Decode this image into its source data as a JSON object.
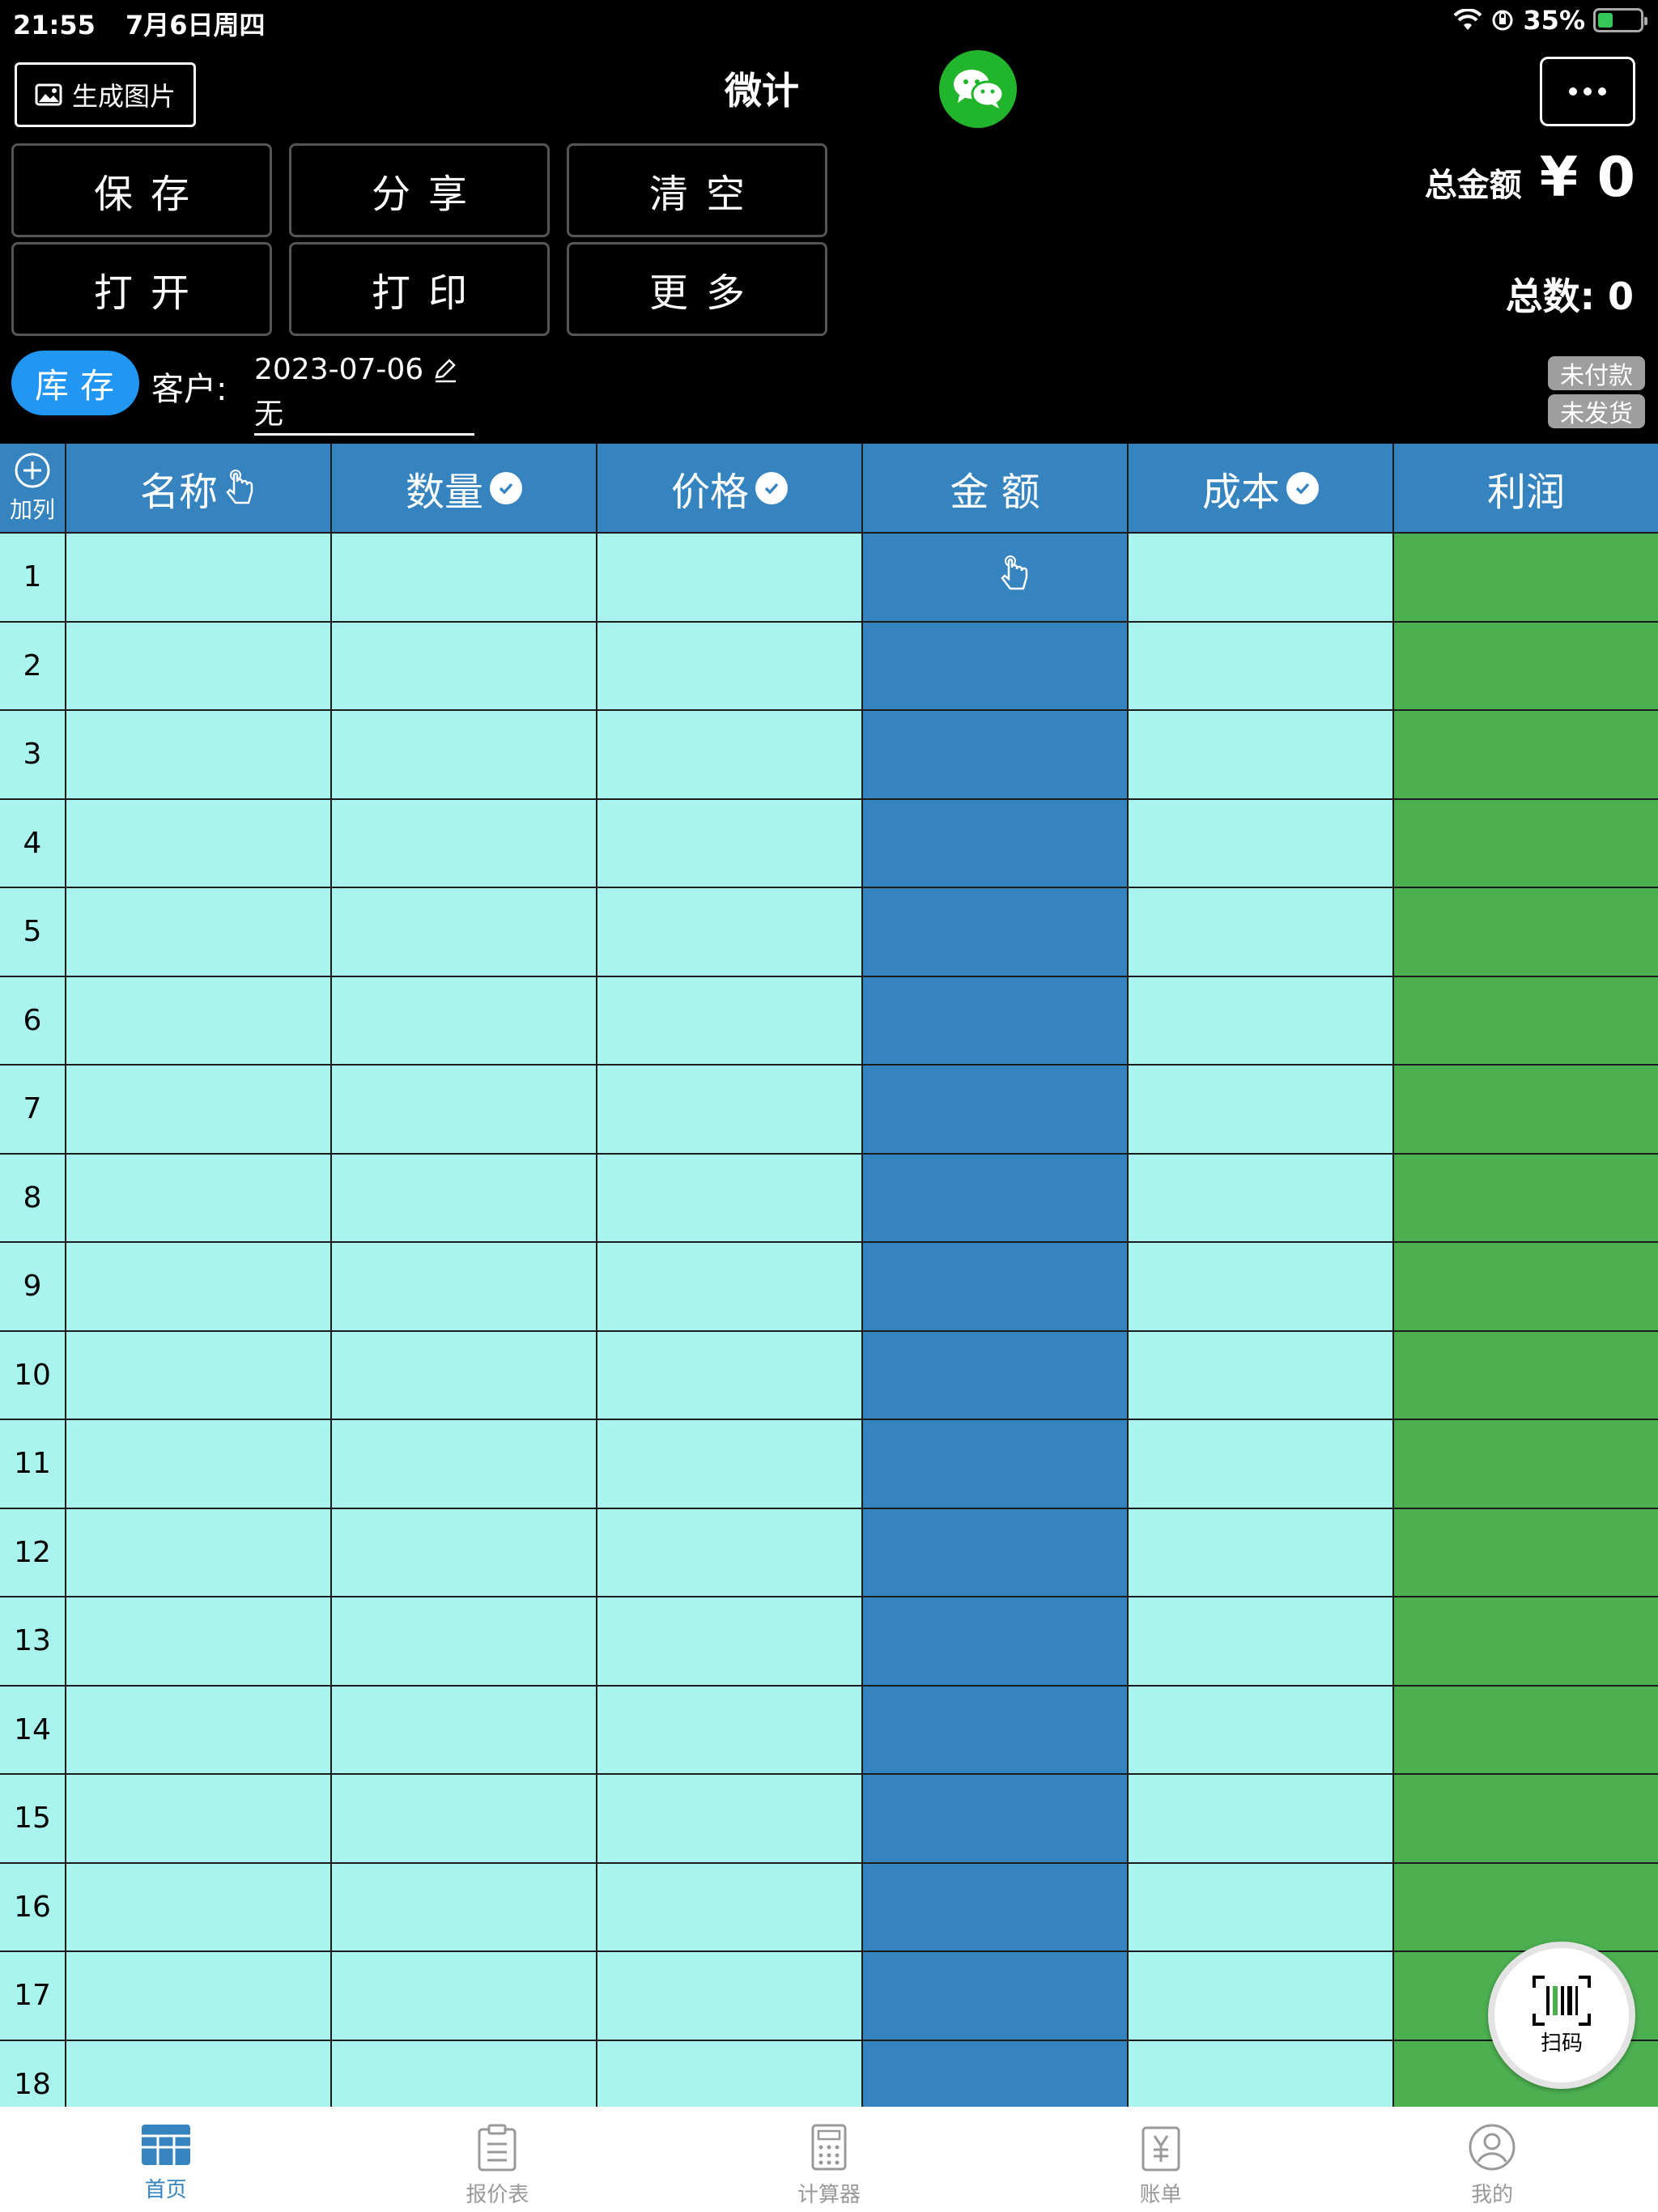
{
  "status": {
    "time": "21:55",
    "date": "7月6日周四",
    "battery": "35%",
    "battery_level": 0.35
  },
  "header": {
    "generate_image_label": "生成图片",
    "title": "微计"
  },
  "actions": [
    {
      "label": "保存"
    },
    {
      "label": "分享"
    },
    {
      "label": "清空"
    },
    {
      "label": "打开"
    },
    {
      "label": "打印"
    },
    {
      "label": "更多"
    }
  ],
  "summary": {
    "total_amount_label": "总金额",
    "total_amount_value": "¥ 0",
    "total_count_label": "总数:",
    "total_count_value": "0"
  },
  "customer": {
    "stock_label": "库存",
    "customer_label": "客户:",
    "date": "2023-07-06",
    "name": "无"
  },
  "tags": {
    "unpaid": "未付款",
    "unshipped": "未发货"
  },
  "table": {
    "add_column_label": "加列",
    "columns": [
      {
        "label": "名称",
        "marker": "tap-icon"
      },
      {
        "label": "数量",
        "marker": "check-icon"
      },
      {
        "label": "价格",
        "marker": "check-icon"
      },
      {
        "label": "金 额",
        "marker": ""
      },
      {
        "label": "成本",
        "marker": "check-icon"
      },
      {
        "label": "利润",
        "marker": ""
      }
    ],
    "rows": [
      "1",
      "2",
      "3",
      "4",
      "5",
      "6",
      "7",
      "8",
      "9",
      "10",
      "11",
      "12",
      "13",
      "14",
      "15",
      "16",
      "17",
      "18"
    ]
  },
  "scan_label": "扫码",
  "tabs": [
    {
      "label": "首页",
      "icon": "table-grid-icon",
      "active": true
    },
    {
      "label": "报价表",
      "icon": "clipboard-icon",
      "active": false
    },
    {
      "label": "计算器",
      "icon": "calculator-icon",
      "active": false
    },
    {
      "label": "账单",
      "icon": "bill-icon",
      "active": false
    },
    {
      "label": "我的",
      "icon": "profile-icon",
      "active": false
    }
  ],
  "colors": {
    "header_blue": "#3583bf",
    "cell_light": "#a9f4ef",
    "profit_green": "#4caf50",
    "stock_pill": "#2196f3",
    "wechat_green": "#20b52a"
  }
}
